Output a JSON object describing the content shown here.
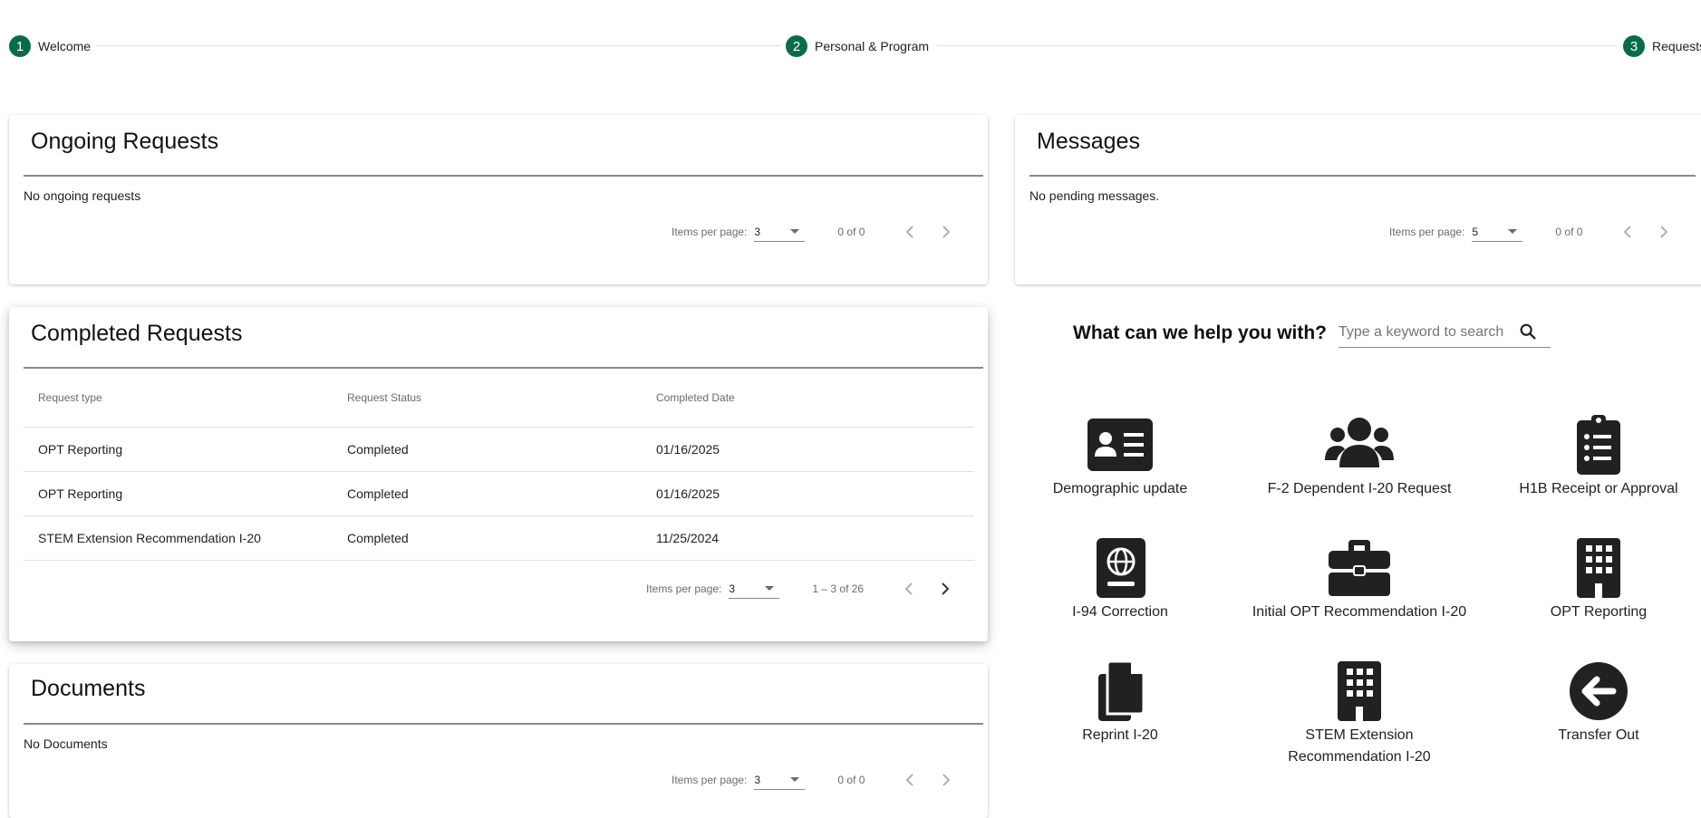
{
  "stepper": {
    "steps": [
      {
        "num": "1",
        "label": "Welcome"
      },
      {
        "num": "2",
        "label": "Personal & Program"
      },
      {
        "num": "3",
        "label": "Requests"
      }
    ]
  },
  "ongoing": {
    "title": "Ongoing Requests",
    "empty": "No ongoing requests",
    "ipp_label": "Items per page:",
    "ipp_value": "3",
    "range": "0 of 0"
  },
  "messages": {
    "title": "Messages",
    "empty": "No pending messages.",
    "ipp_label": "Items per page:",
    "ipp_value": "5",
    "range": "0 of 0"
  },
  "completed": {
    "title": "Completed Requests",
    "columns": [
      "Request type",
      "Request Status",
      "Completed Date"
    ],
    "rows": [
      [
        "OPT Reporting",
        "Completed",
        "01/16/2025"
      ],
      [
        "OPT Reporting",
        "Completed",
        "01/16/2025"
      ],
      [
        "STEM Extension Recommendation I-20",
        "Completed",
        "11/25/2024"
      ]
    ],
    "ipp_label": "Items per page:",
    "ipp_value": "3",
    "range": "1 – 3 of 26"
  },
  "documents": {
    "title": "Documents",
    "empty": "No Documents",
    "ipp_label": "Items per page:",
    "ipp_value": "3",
    "range": "0 of 0"
  },
  "help": {
    "title": "What can we help you with?",
    "search_placeholder": "Type a keyword to search",
    "tiles": [
      {
        "label": "Demographic update",
        "icon": "id-card-icon"
      },
      {
        "label": "F-2 Dependent I-20 Request",
        "icon": "users-icon"
      },
      {
        "label": "H1B Receipt or Approval",
        "icon": "clipboard-list-icon"
      },
      {
        "label": "I-94 Correction",
        "icon": "passport-icon"
      },
      {
        "label": "Initial OPT Recommendation I-20",
        "icon": "briefcase-icon"
      },
      {
        "label": "OPT Reporting",
        "icon": "building-icon"
      },
      {
        "label": "Reprint I-20",
        "icon": "copy-icon"
      },
      {
        "label": "STEM Extension Recommendation I-20",
        "icon": "building-icon"
      },
      {
        "label": "Transfer Out",
        "icon": "arrow-left-circle-icon"
      }
    ]
  },
  "colors": {
    "accent": "#0a6b4a",
    "icon": "#212121"
  }
}
